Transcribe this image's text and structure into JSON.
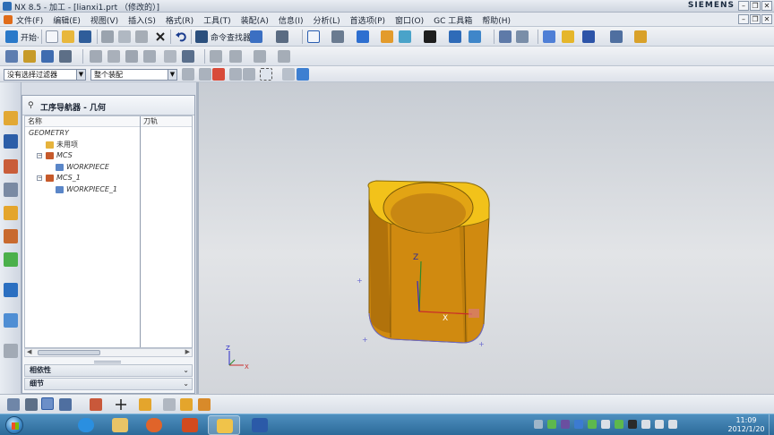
{
  "window": {
    "title": "NX 8.5 - 加工 - [lianxi1.prt （修改的）]",
    "brand": "SIEMENS"
  },
  "menu": {
    "items": [
      "文件(F)",
      "编辑(E)",
      "视图(V)",
      "插入(S)",
      "格式(R)",
      "工具(T)",
      "装配(A)",
      "信息(I)",
      "分析(L)",
      "首选项(P)",
      "窗口(O)",
      "GC 工具箱",
      "帮助(H)"
    ]
  },
  "toolbar": {
    "start_label": "开始·",
    "command_finder_label": "命令查找器"
  },
  "selection_bar": {
    "filter_value": "没有选择过滤器",
    "scope_value": "整个装配"
  },
  "navigator": {
    "title": "工序导航器 - 几何",
    "columns": [
      "名称",
      "刀轨"
    ],
    "rows": [
      {
        "label": "GEOMETRY",
        "level": 0,
        "expander": "",
        "icon": "none-icon",
        "italic": true
      },
      {
        "label": "未用项",
        "level": 1,
        "expander": "",
        "icon": "folder-icon",
        "italic": false
      },
      {
        "label": "MCS",
        "level": 1,
        "expander": "−",
        "icon": "mcs-icon",
        "italic": true
      },
      {
        "label": "WORKPIECE",
        "level": 2,
        "expander": "",
        "icon": "workpiece-icon",
        "italic": true
      },
      {
        "label": "MCS_1",
        "level": 1,
        "expander": "−",
        "icon": "mcs-icon",
        "italic": true
      },
      {
        "label": "WORKPIECE_1",
        "level": 2,
        "expander": "",
        "icon": "workpiece-icon",
        "italic": true
      }
    ],
    "sections": [
      "相依性",
      "细节"
    ]
  },
  "viewport": {
    "triad_labels": {
      "x": "X",
      "y": "Y",
      "z": "Z"
    },
    "part_color": "#d9930f",
    "part_top_color": "#f2c21a",
    "background_top": "#c7ccd3",
    "background_bottom": "#e2e4e7"
  },
  "taskbar": {
    "time": "11:09",
    "date": "2012/1/20"
  }
}
